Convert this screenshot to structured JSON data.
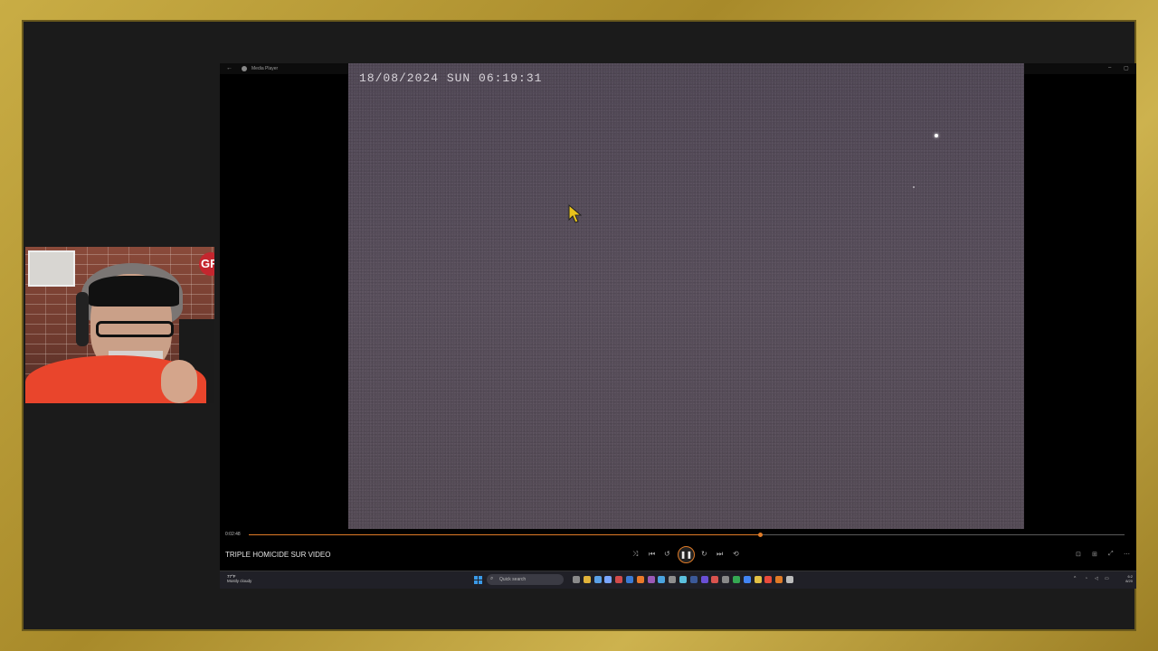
{
  "player": {
    "app_title": "Media Player",
    "back_glyph": "←",
    "window_controls": [
      "–",
      "▢"
    ],
    "video": {
      "timestamp": "18/08/2024 SUN 06:19:31"
    },
    "progress": {
      "elapsed": "0:02:48",
      "fraction": 0.584,
      "accent": "#e07b27"
    },
    "title": "TRIPLE HOMICIDE SUR VIDEO",
    "controls": {
      "shuffle": "⤨",
      "previous": "⏮",
      "rewind": "↺",
      "play_pause": "❚❚",
      "forward": "↻",
      "next": "⏭",
      "repeat": "⟲"
    },
    "right_controls": [
      "⊡",
      "⊞",
      "⤢",
      "⋯"
    ]
  },
  "taskbar": {
    "weather_temp": "77°F",
    "weather_desc": "Mostly cloudy",
    "search_placeholder": "Quick search",
    "clock_time": "6:2",
    "clock_date": "8/20",
    "icon_colors": [
      "#8a8a8a",
      "#e0b23a",
      "#5aa0e6",
      "#7aa6ff",
      "#d14b4b",
      "#3a7bd5",
      "#ea7a2a",
      "#9b59b6",
      "#4aa3df",
      "#8e8e8e",
      "#5bc0de",
      "#3b5998",
      "#6a4fd6",
      "#d9534f",
      "#888",
      "#35a853",
      "#4285f4",
      "#e2c044",
      "#e94b3c",
      "#e07b27",
      "#bbbbbb"
    ]
  },
  "webcam": {
    "badge": "GR"
  }
}
